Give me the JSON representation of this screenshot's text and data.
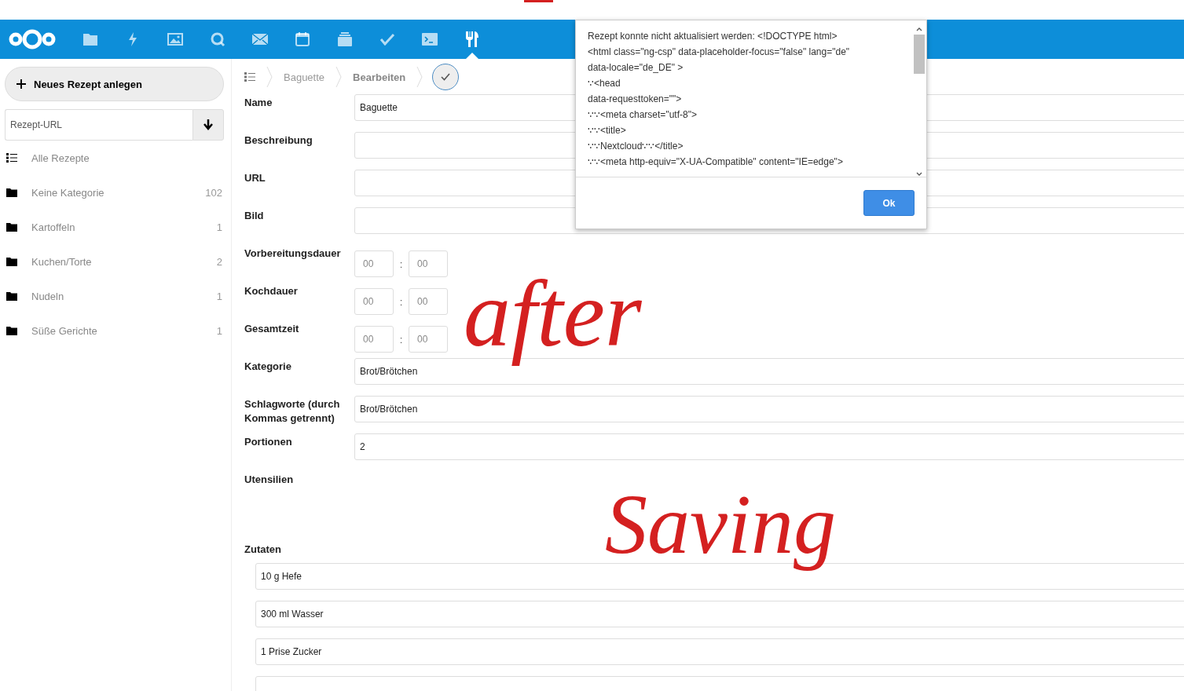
{
  "header": {
    "apps": [
      {
        "kind": "folder",
        "selected": false
      },
      {
        "kind": "bolt",
        "selected": false
      },
      {
        "kind": "image",
        "selected": false
      },
      {
        "kind": "chat",
        "selected": false
      },
      {
        "kind": "mail",
        "selected": false
      },
      {
        "kind": "calendar",
        "selected": false
      },
      {
        "kind": "stack",
        "selected": false
      },
      {
        "kind": "check",
        "selected": false
      },
      {
        "kind": "terminal",
        "selected": false
      },
      {
        "kind": "cutlery",
        "selected": true
      }
    ]
  },
  "sidebar": {
    "new_button": "Neues Rezept anlegen",
    "url_field": {
      "placeholder": "Rezept-URL"
    },
    "items": [
      {
        "kind": "list",
        "label": "Alle Rezepte"
      },
      {
        "kind": "folder",
        "label": "Keine Kategorie",
        "count": "102"
      },
      {
        "kind": "folder",
        "label": "Kartoffeln",
        "count": "1"
      },
      {
        "kind": "folder",
        "label": "Kuchen/Torte",
        "count": "2"
      },
      {
        "kind": "folder",
        "label": "Nudeln",
        "count": "1"
      },
      {
        "kind": "folder",
        "label": "Süße Gerichte",
        "count": "1"
      }
    ]
  },
  "breadcrumb": [
    "Baguette",
    "Bearbeiten"
  ],
  "form": [
    {
      "kind": "text",
      "label": "Name",
      "value": "Baguette"
    },
    {
      "kind": "text",
      "label": "Beschreibung"
    },
    {
      "kind": "text",
      "label": "URL"
    },
    {
      "kind": "text",
      "label": "Bild"
    },
    {
      "kind": "time",
      "label": "Vorbereitungsdauer",
      "placeholders": [
        "00",
        "00"
      ],
      "separator": ":"
    },
    {
      "kind": "time",
      "label": "Kochdauer",
      "placeholders": [
        "00",
        "00"
      ],
      "separator": ":"
    },
    {
      "kind": "time",
      "label": "Gesamtzeit",
      "placeholders": [
        "00",
        "00"
      ],
      "separator": ":"
    },
    {
      "kind": "text",
      "label": "Kategorie",
      "value": "Brot/Brötchen"
    },
    {
      "kind": "text",
      "label": "Schlagworte (durch Kommas getrennt)",
      "value": "Brot/Brötchen"
    },
    {
      "kind": "text",
      "label": "Portionen",
      "value": "2"
    },
    {
      "kind": "empty",
      "label": "Utensilien"
    }
  ],
  "ingredients": {
    "label": "Zutaten",
    "items": [
      "10 g Hefe",
      "300 ml Wasser",
      "1 Prise Zucker"
    ]
  },
  "dialog": {
    "lines": [
      "Rezept konnte nicht aktualisiert werden: <!DOCTYPE html>",
      "<html class=\"ng-csp\" data-placeholder-focus=\"false\" lang=\"de\"",
      "data-locale=\"de_DE\" >",
      "∵<head",
      " data-requesttoken=\"\">",
      "∵∵<meta charset=\"utf-8\">",
      "∵∵<title>",
      "∵∵Nextcloud∵∵</title>",
      "∵∵<meta http-equiv=\"X-UA-Compatible\" content=\"IE=edge\">"
    ],
    "button": "Ok"
  },
  "annotation": [
    "after",
    "Saving"
  ]
}
